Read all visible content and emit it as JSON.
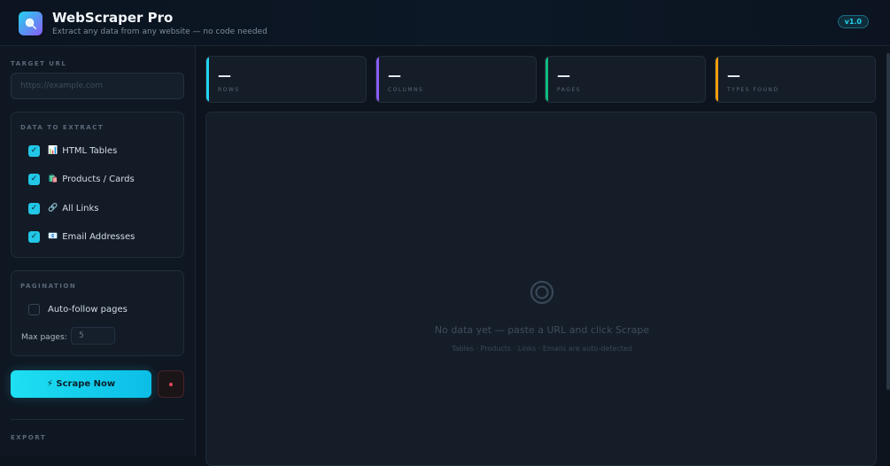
{
  "header": {
    "title": "WebScraper Pro",
    "subtitle": "Extract any data from any website — no code needed",
    "version": "v1.0",
    "logo_icon": "search-icon"
  },
  "sidebar": {
    "target_url_label": "TARGET URL",
    "url_placeholder": "https://example.com",
    "data_label": "DATA TO EXTRACT",
    "options": [
      {
        "emoji": "📊",
        "label": "HTML Tables",
        "checked": true
      },
      {
        "emoji": "🛍️",
        "label": "Products / Cards",
        "checked": true
      },
      {
        "emoji": "🔗",
        "label": "All Links",
        "checked": true
      },
      {
        "emoji": "📧",
        "label": "Email Addresses",
        "checked": true
      }
    ],
    "pagination_label": "PAGINATION",
    "auto_follow_label": "Auto-follow pages",
    "auto_follow_checked": false,
    "max_pages_label": "Max pages:",
    "max_pages_value": "5",
    "scrape_button": "⚡ Scrape Now",
    "export_label": "EXPORT"
  },
  "stats": [
    {
      "value": "—",
      "label": "ROWS",
      "color": "#22d3ee"
    },
    {
      "value": "—",
      "label": "COLUMNS",
      "color": "#8b5cf6"
    },
    {
      "value": "—",
      "label": "PAGES",
      "color": "#10b981"
    },
    {
      "value": "—",
      "label": "TYPES FOUND",
      "color": "#f59e0b"
    }
  ],
  "main": {
    "empty_title": "No data yet — paste a URL and click Scrape",
    "empty_subtitle": "Tables · Products · Links · Emails are auto-detected"
  }
}
